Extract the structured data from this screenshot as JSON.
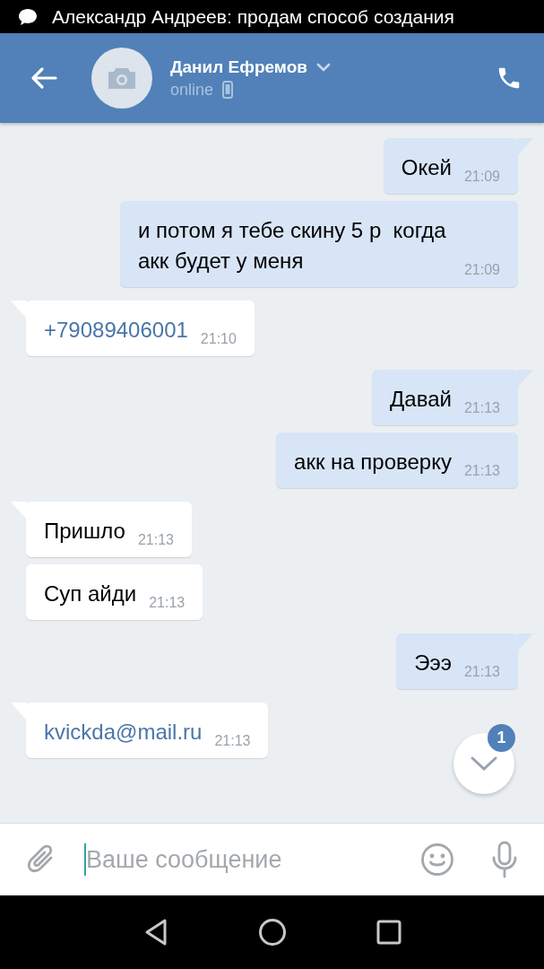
{
  "status_bar": {
    "notification": "Александр Андреев: продам способ создания"
  },
  "header": {
    "contact_name": "Данил Ефремов",
    "presence": "online",
    "mobile": true
  },
  "messages": [
    {
      "outgoing": true,
      "kind": "text",
      "text": "Окей",
      "time": "21:09",
      "tail": true
    },
    {
      "outgoing": true,
      "kind": "text",
      "text": "и потом я тебе скину 5 р  когда акк будет у меня",
      "time": "21:09",
      "tail": false
    },
    {
      "outgoing": false,
      "kind": "link",
      "text": "+79089406001",
      "time": "21:10",
      "tail": true
    },
    {
      "outgoing": true,
      "kind": "text",
      "text": "Давай",
      "time": "21:13",
      "tail": true
    },
    {
      "outgoing": true,
      "kind": "text",
      "text": "акк на проверку",
      "time": "21:13",
      "tail": false
    },
    {
      "outgoing": false,
      "kind": "text",
      "text": "Пришло",
      "time": "21:13",
      "tail": true
    },
    {
      "outgoing": false,
      "kind": "text",
      "text": "Суп айди",
      "time": "21:13",
      "tail": false
    },
    {
      "outgoing": true,
      "kind": "text",
      "text": "Эээ",
      "time": "21:13",
      "tail": true
    },
    {
      "outgoing": false,
      "kind": "link",
      "text": "kvickda@mail.ru",
      "time": "21:13",
      "tail": true
    }
  ],
  "scroll_button": {
    "badge": "1"
  },
  "composer": {
    "placeholder": "Ваше сообщение"
  }
}
